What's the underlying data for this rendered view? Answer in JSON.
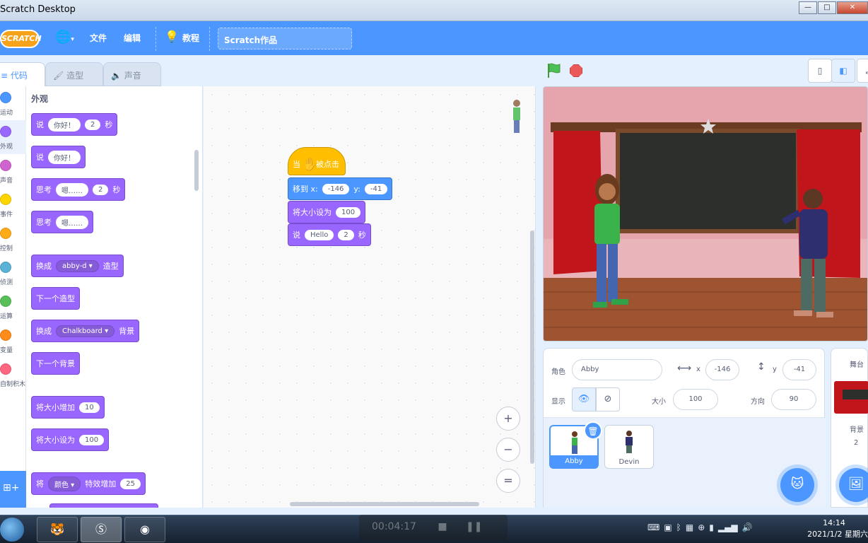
{
  "window": {
    "title": "Scratch Desktop",
    "controls": [
      "—",
      "□",
      "✕"
    ]
  },
  "menubar": {
    "logo": "SCRATCH",
    "file": "文件",
    "edit": "编辑",
    "tutorials": "教程",
    "project_title": "Scratch作品"
  },
  "tabs": {
    "code": "代码",
    "costumes": "造型",
    "sounds": "声音"
  },
  "categories": [
    {
      "label": "运动",
      "color": "#4c97ff"
    },
    {
      "label": "外观",
      "color": "#9966ff"
    },
    {
      "label": "声音",
      "color": "#cf63cf"
    },
    {
      "label": "事件",
      "color": "#ffd500"
    },
    {
      "label": "控制",
      "color": "#ffab19"
    },
    {
      "label": "侦测",
      "color": "#5cb1d6"
    },
    {
      "label": "运算",
      "color": "#59c059"
    },
    {
      "label": "变量",
      "color": "#ff8c1a"
    },
    {
      "label": "自制积木",
      "color": "#ff6680"
    }
  ],
  "palette": {
    "section_title": "外观",
    "say_secs": {
      "verb": "说",
      "text": "你好！",
      "secs": "2",
      "unit": "秒"
    },
    "say": {
      "verb": "说",
      "text": "你好！"
    },
    "think_secs": {
      "verb": "思考",
      "text": "嗯……",
      "secs": "2",
      "unit": "秒"
    },
    "think": {
      "verb": "思考",
      "text": "嗯……"
    },
    "switch_costume": {
      "pre": "换成",
      "costume": "abby-d ▾",
      "post": "造型"
    },
    "next_costume": "下一个造型",
    "switch_backdrop": {
      "pre": "换成",
      "backdrop": "Chalkboard ▾",
      "post": "背景"
    },
    "next_backdrop": "下一个背景",
    "change_size": {
      "label": "将大小增加",
      "value": "10"
    },
    "set_size": {
      "label": "将大小设为",
      "value": "100"
    },
    "change_effect": {
      "pre": "将",
      "effect": "颜色 ▾",
      "post": "特效增加",
      "value": "25"
    }
  },
  "script": {
    "hat": {
      "pre": "当",
      "post": "被点击"
    },
    "goto": {
      "label": "移到 x:",
      "x": "-146",
      "ylabel": "y:",
      "y": "-41"
    },
    "set_size": {
      "label": "将大小设为",
      "value": "100"
    },
    "say": {
      "verb": "说",
      "text": "Hello",
      "secs": "2",
      "unit": "秒"
    }
  },
  "zoom": {
    "in": "+",
    "out": "−",
    "reset": "="
  },
  "sprite_info": {
    "sprite_label": "角色",
    "sprite_name": "Abby",
    "x_label": "x",
    "x": "-146",
    "y_label": "y",
    "y": "-41",
    "show_label": "显示",
    "size_label": "大小",
    "size": "100",
    "direction_label": "方向",
    "direction": "90"
  },
  "sprites": [
    {
      "name": "Abby",
      "selected": true
    },
    {
      "name": "Devin",
      "selected": false
    }
  ],
  "stage_pane": {
    "label": "舞台",
    "backdrops_label": "背景",
    "backdrops_count": "2"
  },
  "taskbar": {
    "timer": "00:04:17",
    "time": "14:14",
    "date": "2021/1/2 星期六"
  }
}
